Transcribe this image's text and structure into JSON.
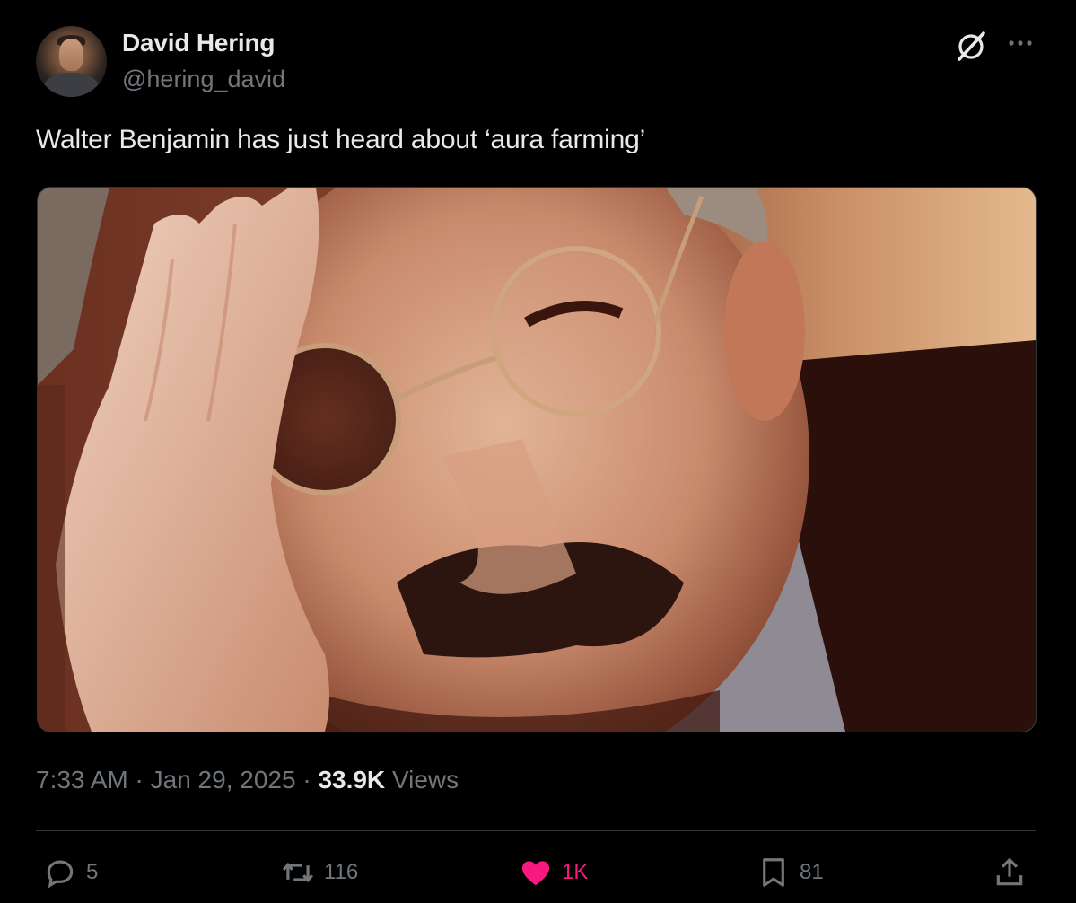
{
  "author": {
    "display_name": "David Hering",
    "handle": "@hering_david",
    "avatar_icon": "user-avatar"
  },
  "tweet": {
    "text": "Walter Benjamin has just heard about ‘aura farming’",
    "media_icon": "photo"
  },
  "meta": {
    "time": "7:33 AM",
    "separator": "·",
    "date": "Jan 29, 2025",
    "views_count": "33.9K",
    "views_label": "Views"
  },
  "actions": {
    "reply": {
      "count": "5",
      "icon": "reply-icon"
    },
    "repost": {
      "count": "116",
      "icon": "repost-icon"
    },
    "like": {
      "count": "1K",
      "icon": "heart-icon",
      "active": true,
      "color": "#f91880"
    },
    "bookmark": {
      "count": "81",
      "icon": "bookmark-icon"
    },
    "share": {
      "icon": "share-icon"
    }
  },
  "header_icons": {
    "grok": "grok-icon",
    "more": "more-icon"
  }
}
